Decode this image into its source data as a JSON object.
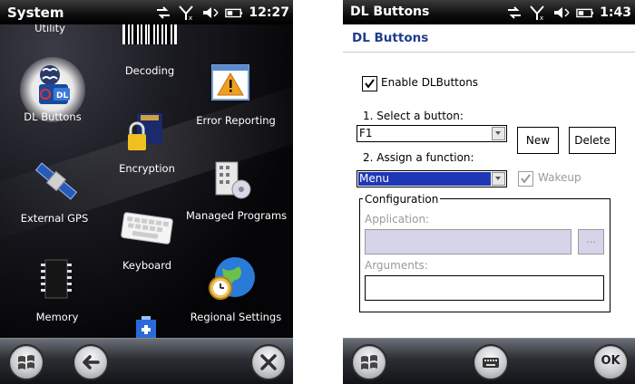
{
  "left": {
    "status": {
      "title": "System",
      "time": "12:27"
    },
    "partial_top": {
      "utility_label": "Utility"
    },
    "apps": [
      {
        "label": "Decoding",
        "icon": "barcode-icon"
      },
      {
        "label": "DL Buttons",
        "icon": "dl-buttons-icon"
      },
      {
        "label": "Error Reporting",
        "icon": "error-reporting-icon"
      },
      {
        "label": "Encryption",
        "icon": "encryption-icon"
      },
      {
        "label": "External GPS",
        "icon": "satellite-icon"
      },
      {
        "label": "Managed Programs",
        "icon": "managed-programs-icon"
      },
      {
        "label": "Keyboard",
        "icon": "keyboard-icon"
      },
      {
        "label": "Memory",
        "icon": "memory-chip-icon"
      },
      {
        "label": "Regional Settings",
        "icon": "globe-clock-icon"
      }
    ],
    "softbar": {
      "start": "windows-start-icon",
      "back": "back-arrow-icon",
      "close": "close-icon"
    }
  },
  "right": {
    "status": {
      "title": "DL Buttons",
      "time": "1:43"
    },
    "header": "DL Buttons",
    "enable_label": "Enable DLButtons",
    "enable_checked": true,
    "select_label": "1. Select a button:",
    "selected_button": "F1",
    "new_label": "New",
    "delete_label": "Delete",
    "assign_label": "2. Assign a function:",
    "assigned_function": "Menu",
    "wakeup_label": "Wakeup",
    "wakeup_checked": true,
    "config_label": "Configuration",
    "application_label": "Application:",
    "application_value": "",
    "browse_label": "...",
    "arguments_label": "Arguments:",
    "arguments_value": "",
    "softbar": {
      "start": "windows-start-icon",
      "keyboard": "keyboard-icon",
      "ok": "OK"
    }
  },
  "colors": {
    "header_blue": "#1f3c8c",
    "selection_blue": "#1e37b4",
    "disabled_fill": "#d6d4e8"
  }
}
